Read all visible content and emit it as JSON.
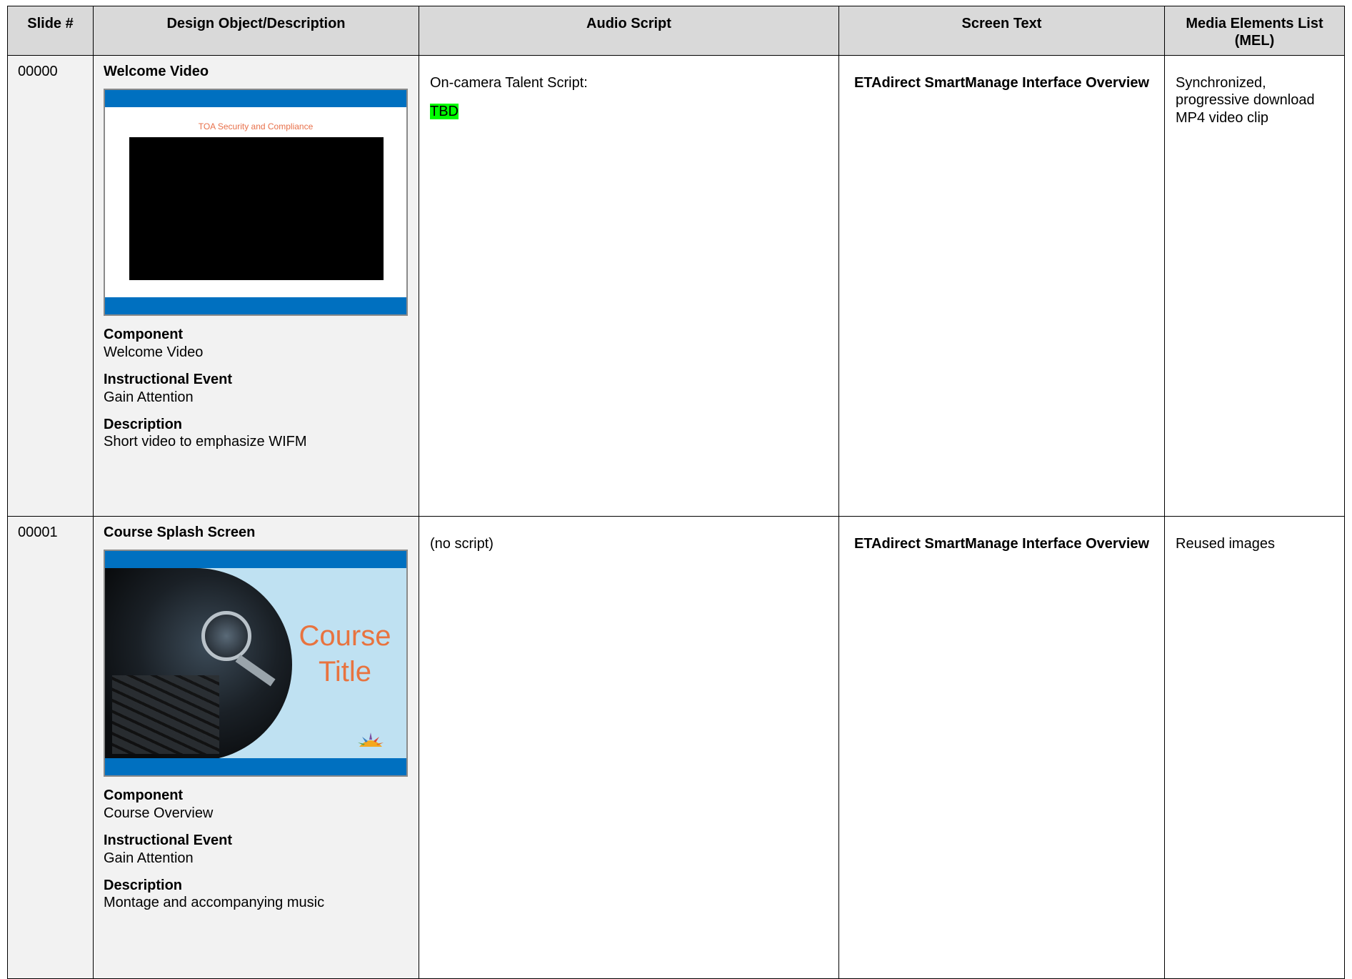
{
  "headers": {
    "slide": "Slide #",
    "design": "Design Object/Description",
    "audio": "Audio Script",
    "screen": "Screen Text",
    "mel": "Media Elements List (MEL)"
  },
  "labels": {
    "component": "Component",
    "instructional_event": "Instructional Event",
    "description": "Description"
  },
  "rows": [
    {
      "slide": "00000",
      "title": "Welcome Video",
      "thumb_caption": "TOA Security and Compliance",
      "component": "Welcome Video",
      "instructional_event": "Gain Attention",
      "description": "Short video to emphasize WIFM",
      "audio_intro": "On-camera Talent Script:",
      "audio_highlight": "TBD",
      "screen_text": "ETAdirect SmartManage Interface Overview",
      "mel": "Synchronized, progressive download MP4 video clip"
    },
    {
      "slide": "00001",
      "title": "Course Splash Screen",
      "thumb_title_line1": "Course",
      "thumb_title_line2": "Title",
      "component": "Course Overview",
      "instructional_event": "Gain Attention",
      "description": "Montage and accompanying music",
      "audio_intro": "(no script)",
      "screen_text": "ETAdirect SmartManage Interface Overview",
      "mel": "Reused images"
    }
  ],
  "colors": {
    "header_bg": "#d9d9d9",
    "side_bg": "#f2f2f2",
    "accent_blue": "#0070c0",
    "highlight_green": "#00ff00",
    "title_orange": "#e8733f"
  }
}
